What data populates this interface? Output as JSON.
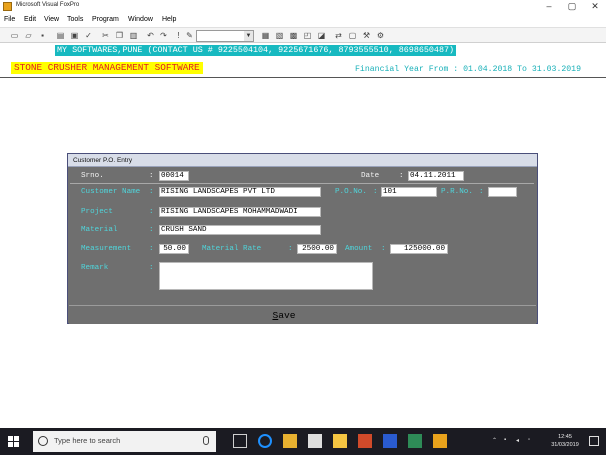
{
  "window": {
    "title": "Microsoft Visual FoxPro",
    "controls": [
      "–",
      "▢",
      "✕"
    ]
  },
  "menu": [
    "File",
    "Edit",
    "View",
    "Tools",
    "Program",
    "Window",
    "Help"
  ],
  "toolbar": {
    "icons": [
      "new-file-icon",
      "open-folder-icon",
      "save-icon",
      "print-icon",
      "print-preview-icon",
      "spelling-icon",
      "cut-icon",
      "copy-icon",
      "paste-icon",
      "undo-icon",
      "redo-icon",
      "run-icon",
      "modify-form-icon",
      "form-wizard-icon",
      "report-icon",
      "table-icon",
      "browse-icon",
      "filter-icon",
      "properties-icon",
      "command-window-icon",
      "debugger-icon",
      "tools-icon"
    ],
    "combo_value": ""
  },
  "workspace": {
    "banner": "MY SOFTWARES,PUNE (CONTACT US # 9225504104, 9225671676, 8793555510, 8698650487)",
    "app_title": "STONE CRUSHER MANAGEMENT SOFTWARE",
    "financial_year": "Financial Year From : 01.04.2018 To 31.03.2019"
  },
  "dialog": {
    "title": "Customer P.O. Entry",
    "srno_label": "Srno.",
    "srno_value": "00014",
    "date_label": "Date",
    "date_value": "04.11.2011",
    "customer_label": "Customer Name",
    "customer_value": "RISING LANDSCAPES PVT LTD",
    "po_label": "P.O.No.",
    "po_value": "101",
    "pr_label": "P.R.No.",
    "pr_value": "",
    "project_label": "Project",
    "project_value": "RISING LANDSCAPES MOHAMMADWADI",
    "material_label": "Material",
    "material_value": "CRUSH SAND",
    "measurement_label": "Measurement",
    "measurement_value": "50.00",
    "rate_label": "Material Rate",
    "rate_value": "2500.00",
    "amount_label": "Amount",
    "amount_value": "125000.00",
    "remark_label": "Remark",
    "remark_value": "",
    "colon": ":",
    "save_label_hotkey": "S",
    "save_label_rest": "ave"
  },
  "taskbar": {
    "search_placeholder": "Type here to search",
    "time": "12:45",
    "date": "31/03/2019"
  },
  "colors": {
    "banner_bg": "#17b9c0",
    "title_bg": "#ffff00",
    "title_fg": "#e02020",
    "dialog_bg": "#6f6f6f",
    "label_cyan": "#4fd6dc"
  }
}
